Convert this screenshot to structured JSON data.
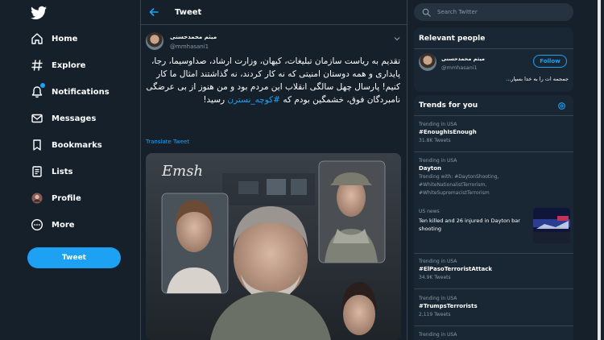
{
  "nav": {
    "items": [
      {
        "label": "Home",
        "icon": "home-icon"
      },
      {
        "label": "Explore",
        "icon": "hashtag-icon"
      },
      {
        "label": "Notifications",
        "icon": "bell-icon"
      },
      {
        "label": "Messages",
        "icon": "mail-icon"
      },
      {
        "label": "Bookmarks",
        "icon": "bookmark-icon"
      },
      {
        "label": "Lists",
        "icon": "list-icon"
      },
      {
        "label": "Profile",
        "icon": "avatar-icon"
      },
      {
        "label": "More",
        "icon": "more-icon"
      }
    ],
    "tweet_button": "Tweet"
  },
  "main": {
    "header_title": "Tweet",
    "tweet": {
      "author_name": "میثم محمدحسنی",
      "author_handle": "@mmhasani1",
      "text_before_hashtag": "تقدیم به ریاست سازمان تبلیغات، کیهان، وزارت ارشاد، صداوسیما، رجا، پایداری و همه دوستان امنیتی که نه کار کردند، نه گذاشتند امثال ما کار کنیم! پارسال چهل سالگی انقلاب این مردم بود و من هنوز از بی عرضگی نامبردگان فوق، خشمگین بودم که",
      "hashtag": "#کوچه_نسترن",
      "text_after_hashtag": "رسید!",
      "translate_label": "Translate Tweet",
      "poster_logo": "Emsh"
    }
  },
  "search": {
    "placeholder": "Search Twitter"
  },
  "relevant_people": {
    "title": "Relevant people",
    "name": "میثم محمدحسنی",
    "handle": "@mmhasani1",
    "follow_label": "Follow",
    "bio": "جمجمه ات را به خدا بسپار..."
  },
  "trends": {
    "title": "Trends for you",
    "items": [
      {
        "meta": "Trending in USA",
        "name": "#EnoughIsEnough",
        "count": "31.8K Tweets"
      },
      {
        "meta": "Trending in USA",
        "name": "Dayton",
        "context_lines": [
          "Trending with: #DaytonShooting,",
          "#WhiteNationalistTerrorism,",
          "#WhiteSupremacistTerrorism"
        ]
      },
      {
        "meta": "US news",
        "headline": "Ten killed and 26 injured in Dayton bar shooting"
      },
      {
        "meta": "Trending in USA",
        "name": "#ElPasoTerroristAttack",
        "count": "34.9K Tweets"
      },
      {
        "meta": "Trending in USA",
        "name": "#TrumpsTerrorists",
        "count": "2,119 Tweets"
      },
      {
        "meta": "Trending in USA"
      }
    ]
  },
  "colors": {
    "background": "#15202b",
    "panel": "#192734",
    "accent": "#1da1f2",
    "muted_text": "#8899a6",
    "border": "#38444d"
  }
}
